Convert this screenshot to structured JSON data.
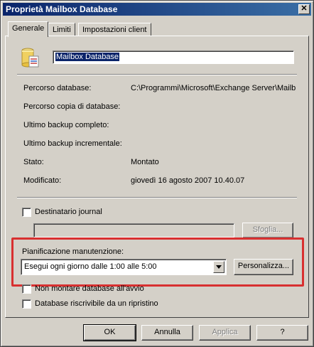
{
  "window": {
    "title": "Proprietà Mailbox Database",
    "close_glyph": "✕"
  },
  "tabs": [
    {
      "label": "Generale",
      "active": true
    },
    {
      "label": "Limiti",
      "active": false
    },
    {
      "label": "Impostazioni client",
      "active": false
    }
  ],
  "general": {
    "icon": "database-icon",
    "name_value": "Mailbox Database",
    "fields": [
      {
        "label": "Percorso database:",
        "value": "C:\\Programmi\\Microsoft\\Exchange Server\\Mailb"
      },
      {
        "label": "Percorso copia di database:",
        "value": ""
      },
      {
        "label": "Ultimo backup completo:",
        "value": ""
      },
      {
        "label": "Ultimo backup incrementale:",
        "value": ""
      },
      {
        "label": "Stato:",
        "value": "Montato"
      },
      {
        "label": "Modificato:",
        "value": "giovedì 16 agosto 2007 10.40.07"
      }
    ],
    "journal": {
      "checkbox_label": "Destinatario journal",
      "checked": false,
      "input_value": "",
      "browse_label": "Sfoglia..."
    },
    "maintenance": {
      "label": "Pianificazione manutenzione:",
      "selected": "Esegui ogni giorno dalle 1:00 alle 5:00",
      "customize_label": "Personalizza..."
    },
    "options": [
      {
        "label": "Non montare database all'avvio",
        "checked": false
      },
      {
        "label": "Database riscrivibile da un ripristino",
        "checked": false
      }
    ]
  },
  "buttons": {
    "ok": "OK",
    "cancel": "Annulla",
    "apply": "Applica",
    "help": "?"
  },
  "colors": {
    "titlebar_start": "#0a246a",
    "titlebar_end": "#3a6ea5",
    "highlight_border": "#d83030",
    "face": "#d4d0c8"
  }
}
